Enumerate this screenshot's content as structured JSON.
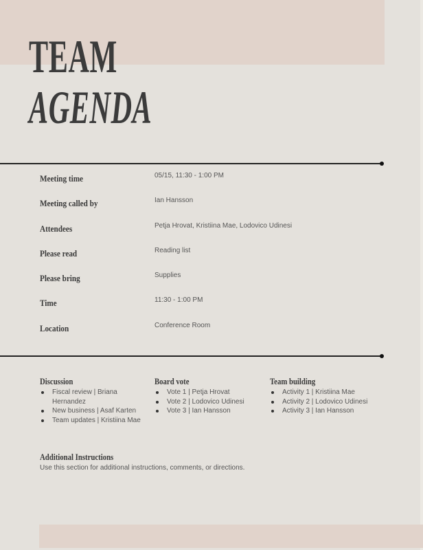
{
  "title": {
    "line1": "TEAM",
    "line2": "AGENDA"
  },
  "details": [
    {
      "label": "Meeting time",
      "value": "05/15, 11:30 - 1:00 PM"
    },
    {
      "label": "Meeting called by",
      "value": "Ian Hansson"
    },
    {
      "label": "Attendees",
      "value": "Petja Hrovat, Kristiina Mae, Lodovico Udinesi"
    },
    {
      "label": "Please read",
      "value": "Reading list"
    },
    {
      "label": "Please bring",
      "value": "Supplies"
    },
    {
      "label": "Time",
      "value": "11:30 - 1:00 PM"
    },
    {
      "label": "Location",
      "value": "Conference Room"
    }
  ],
  "sections": [
    {
      "heading": "Discussion",
      "items": [
        "Fiscal review | Briana Hernandez",
        "New business | Asaf Karten",
        "Team updates | Kristiina Mae"
      ]
    },
    {
      "heading": "Board vote",
      "items": [
        "Vote 1 | Petja Hrovat",
        "Vote 2 | Lodovico Udinesi",
        "Vote 3 | Ian Hansson"
      ]
    },
    {
      "heading": "Team building",
      "items": [
        "Activity 1 | Kristiina Mae",
        "Activity 2 | Lodovico Udinesi",
        "Activity 3 | Ian Hansson"
      ]
    }
  ],
  "additional": {
    "heading": "Additional Instructions",
    "text": "Use this section for additional instructions, comments, or directions."
  },
  "colors": {
    "accent_band": "#e1d3cb",
    "background": "#e4e1dc",
    "rule": "#222222"
  }
}
